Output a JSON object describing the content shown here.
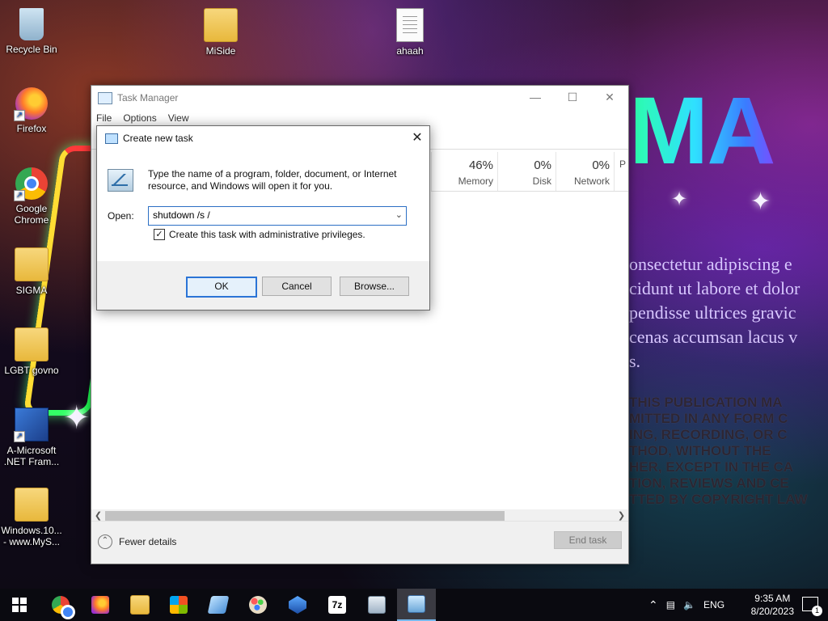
{
  "desktop": {
    "icons": [
      {
        "label": "Recycle Bin"
      },
      {
        "label": "MiSide"
      },
      {
        "label": "ahaah"
      },
      {
        "label": "Firefox"
      },
      {
        "label": "Google Chrome"
      },
      {
        "label": "SIGMA"
      },
      {
        "label": "LGBT govno"
      },
      {
        "label": "A-Microsoft .NET Fram..."
      },
      {
        "label": "Windows.10... - www.MyS..."
      }
    ],
    "wallpaper": {
      "headline": "MA",
      "lorem_lines": [
        "onsectetur adipiscing e",
        "cidunt ut labore et dolor",
        "pendisse ultrices gravic",
        "cenas accumsan lacus v",
        "s."
      ],
      "legal_lines": [
        "THIS PUBLICATION MA",
        "MITTED IN ANY FORM C",
        "ING, RECORDING, OR C",
        "THOD, WITHOUT THE",
        "HER, EXCEPT IN THE CA",
        "TION, REVIEWS AND CE",
        "TTED BY COPYRIGHT LAW"
      ]
    }
  },
  "task_manager": {
    "title": "Task Manager",
    "menu": [
      "File",
      "Options",
      "View"
    ],
    "columns": [
      {
        "pct": "46%",
        "label": "Memory"
      },
      {
        "pct": "0%",
        "label": "Disk"
      },
      {
        "pct": "0%",
        "label": "Network"
      },
      {
        "pct": "",
        "label": "P"
      }
    ],
    "fewer_details": "Fewer details",
    "end_task": "End task"
  },
  "dialog": {
    "title": "Create new task",
    "message": "Type the name of a program, folder, document, or Internet resource, and Windows will open it for you.",
    "open_label": "Open:",
    "open_value": "shutdown /s /",
    "admin_checkbox": {
      "label": "Create this task with administrative privileges.",
      "checked": true
    },
    "buttons": {
      "ok": "OK",
      "cancel": "Cancel",
      "browse": "Browse..."
    }
  },
  "taskbar": {
    "apps": [
      "start",
      "chrome",
      "firefox",
      "file-explorer",
      "store",
      "app-5",
      "paint",
      "app-7",
      "7zip",
      "app-9",
      "task-manager"
    ],
    "language": "ENG",
    "time": "9:35 AM",
    "date": "8/20/2023",
    "notification_count": "1"
  },
  "colors": {
    "accent": "#2b74d6",
    "taskbar": "#0a0a10"
  }
}
